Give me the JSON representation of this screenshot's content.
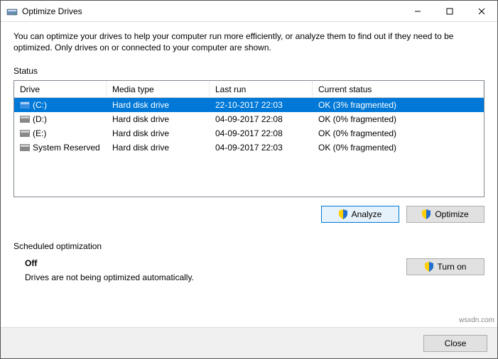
{
  "window": {
    "title": "Optimize Drives"
  },
  "description": "You can optimize your drives to help your computer run more efficiently, or analyze them to find out if they need to be optimized. Only drives on or connected to your computer are shown.",
  "status_label": "Status",
  "columns": {
    "drive": "Drive",
    "media": "Media type",
    "last": "Last run",
    "status": "Current status"
  },
  "drives": [
    {
      "name": "(C:)",
      "media": "Hard disk drive",
      "last": "22-10-2017 22:03",
      "status": "OK (3% fragmented)",
      "selected": true
    },
    {
      "name": "(D:)",
      "media": "Hard disk drive",
      "last": "04-09-2017 22:08",
      "status": "OK (0% fragmented)",
      "selected": false
    },
    {
      "name": "(E:)",
      "media": "Hard disk drive",
      "last": "04-09-2017 22:08",
      "status": "OK (0% fragmented)",
      "selected": false
    },
    {
      "name": "System Reserved",
      "media": "Hard disk drive",
      "last": "04-09-2017 22:03",
      "status": "OK (0% fragmented)",
      "selected": false
    }
  ],
  "buttons": {
    "analyze": "Analyze",
    "optimize": "Optimize",
    "turn_on": "Turn on",
    "close": "Close"
  },
  "schedule": {
    "label": "Scheduled optimization",
    "state": "Off",
    "desc": "Drives are not being optimized automatically."
  },
  "watermark": "wsxdn.com"
}
